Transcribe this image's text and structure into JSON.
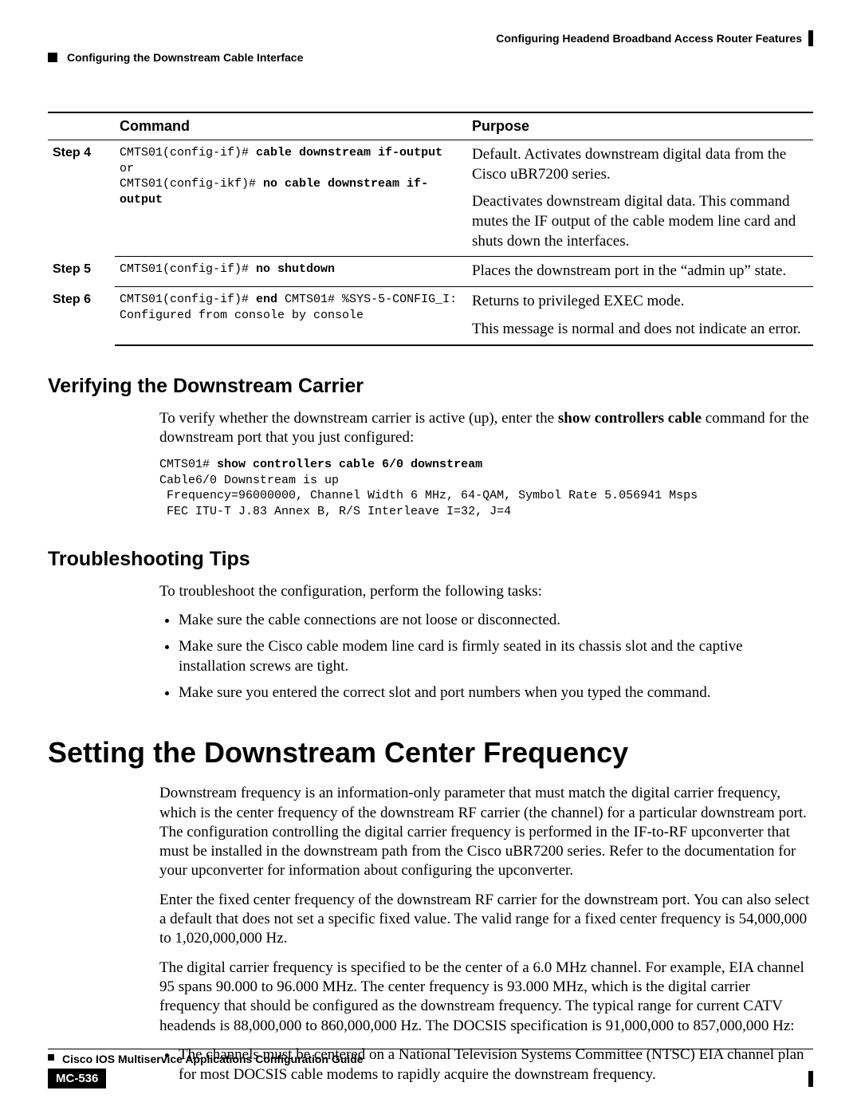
{
  "header": {
    "chapter_title": "Configuring Headend Broadband Access Router Features",
    "section_title": "Configuring the Downstream Cable Interface"
  },
  "table": {
    "header_command": "Command",
    "header_purpose": "Purpose",
    "rows": [
      {
        "step": "Step 4",
        "cmd_l1_prefix": "CMTS01(config-if)# ",
        "cmd_l1_bold": "cable downstream if-output",
        "cmd_l1_suffix": " or",
        "cmd_l2_prefix": "CMTS01(config-ikf)# ",
        "cmd_l2_bold": "no cable downstream if-output",
        "purpose_p1": "Default. Activates downstream digital data from the Cisco uBR7200 series.",
        "purpose_p2": "Deactivates downstream digital data. This command mutes the IF output of the cable modem line card and shuts down the interfaces."
      },
      {
        "step": "Step 5",
        "cmd_prefix": "CMTS01(config-if)# ",
        "cmd_bold": "no shutdown",
        "purpose": "Places the downstream port in the “admin up” state."
      },
      {
        "step": "Step 6",
        "cmd_l1_prefix": "CMTS01(config-if)# ",
        "cmd_l1_bold": "end",
        "cmd_l1_suffix": " CMTS01# %SYS-5-CONFIG_I:",
        "cmd_l2": "Configured from console by console",
        "purpose_p1": "Returns to privileged EXEC mode.",
        "purpose_p2": "This message is normal and does not indicate an error."
      }
    ]
  },
  "verify": {
    "heading": "Verifying the Downstream Carrier",
    "intro_a": "To verify whether the downstream carrier is active (up), enter the ",
    "intro_bold": "show controllers cable",
    "intro_b": " command for the downstream port that you just configured:",
    "code_prefix": "CMTS01# ",
    "code_bold": "show controllers cable 6/0 downstream",
    "code_rest": "Cable6/0 Downstream is up\n Frequency=96000000, Channel Width 6 MHz, 64-QAM, Symbol Rate 5.056941 Msps\n FEC ITU-T J.83 Annex B, R/S Interleave I=32, J=4"
  },
  "troubleshoot": {
    "heading": "Troubleshooting Tips",
    "intro": "To troubleshoot the configuration, perform the following tasks:",
    "bullets": [
      "Make sure the cable connections are not loose or disconnected.",
      "Make sure the Cisco cable modem line card is firmly seated in its chassis slot and the captive installation screws are tight.",
      "Make sure you entered the correct slot and port numbers when you typed the command."
    ]
  },
  "setting": {
    "heading": "Setting the Downstream Center Frequency",
    "p1": "Downstream frequency is an information-only parameter that must match the digital carrier frequency, which is the center frequency of the downstream RF carrier (the channel) for a particular downstream port. The configuration controlling the digital carrier frequency is performed in the IF-to-RF upconverter that must be installed in the downstream path from the Cisco uBR7200 series. Refer to the documentation for your upconverter for information about configuring the upconverter.",
    "p2": "Enter the fixed center frequency of the downstream RF carrier for the downstream port. You can also select a default that does not set a specific fixed value. The valid range for a fixed center frequency is 54,000,000 to 1,020,000,000 Hz.",
    "p3": "The digital carrier frequency is specified to be the center of a 6.0 MHz channel. For example, EIA channel 95 spans 90.000 to 96.000 MHz. The center frequency is 93.000 MHz, which is the digital carrier frequency that should be configured as the downstream frequency. The typical range for current CATV headends is 88,000,000 to 860,000,000 Hz. The DOCSIS specification is 91,000,000 to 857,000,000 Hz:",
    "bullets": [
      "The channels must be centered on a National Television Systems Committee (NTSC) EIA channel plan for most DOCSIS cable modems to rapidly acquire the downstream frequency."
    ]
  },
  "footer": {
    "guide_title": "Cisco IOS Multiservice Applications Configuration Guide",
    "page_number": "MC-536"
  }
}
